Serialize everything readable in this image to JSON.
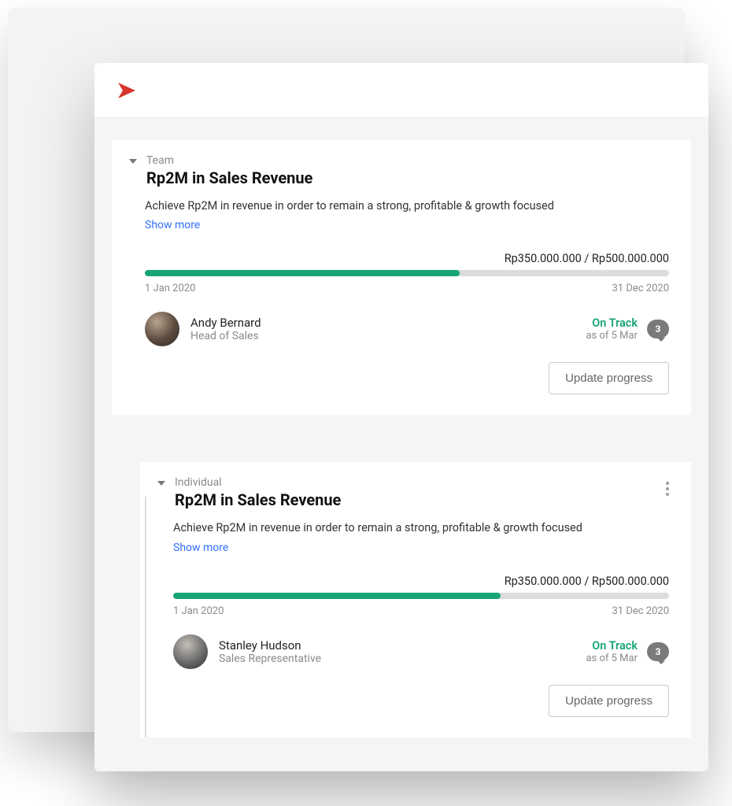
{
  "goals": [
    {
      "type": "Team",
      "title": "Rp2M in Sales Revenue",
      "description": "Achieve Rp2M in revenue in order to remain a strong, profitable & growth focused",
      "show_more": "Show more",
      "progress_text": "Rp350.000.000 / Rp500.000.000",
      "progress_pct": 60,
      "start_date": "1 Jan 2020",
      "end_date": "31 Dec 2020",
      "owner_name": "Andy Bernard",
      "owner_role": "Head of Sales",
      "status": "On Track",
      "status_asof": "as of 5 Mar",
      "comments": "3",
      "update_label": "Update progress"
    },
    {
      "type": "Individual",
      "title": "Rp2M in Sales Revenue",
      "description": "Achieve Rp2M in revenue in order to remain a strong, profitable & growth focused",
      "show_more": "Show more",
      "progress_text": "Rp350.000.000 / Rp500.000.000",
      "progress_pct": 66,
      "start_date": "1 Jan 2020",
      "end_date": "31 Dec 2020",
      "owner_name": "Stanley Hudson",
      "owner_role": "Sales Representative",
      "status": "On Track",
      "status_asof": "as of 5 Mar",
      "comments": "3",
      "update_label": "Update progress"
    }
  ]
}
